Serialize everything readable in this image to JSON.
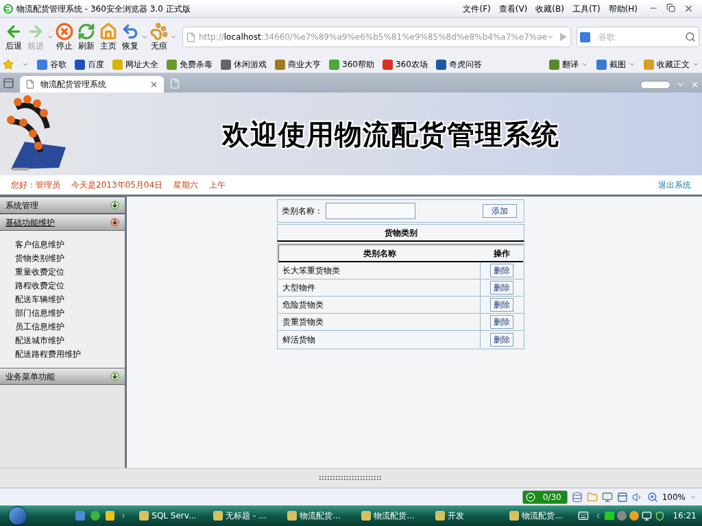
{
  "window": {
    "title": "物流配货管理系统 - 360安全浏览器 3.0 正式版"
  },
  "menu": [
    "文件(F)",
    "查看(V)",
    "收藏(B)",
    "工具(T)",
    "帮助(H)"
  ],
  "toolbar": [
    {
      "label": "后退",
      "disabled": false
    },
    {
      "label": "前进",
      "disabled": true
    },
    {
      "label": "停止",
      "disabled": false
    },
    {
      "label": "刷新",
      "disabled": false
    },
    {
      "label": "主页",
      "disabled": false
    },
    {
      "label": "恢复",
      "disabled": false
    },
    {
      "label": "无痕",
      "disabled": false
    }
  ],
  "address": {
    "scheme": "http://",
    "host": "localhost",
    "rest": ":34660/%e7%89%a9%e6%b5%81%e9%85%8d%e8%b4%a7%e7%ae"
  },
  "search": {
    "placeholder": "谷歌"
  },
  "bookmarks": [
    "谷歌",
    "百度",
    "网址大全",
    "免费杀毒",
    "休闲游戏",
    "商业大亨",
    "360帮助",
    "360农场",
    "奇虎问答"
  ],
  "tools": [
    "翻译",
    "截图",
    "收藏正文"
  ],
  "tabs": [
    {
      "label": "物流配货管理系统",
      "selected": true
    }
  ],
  "banner": {
    "title": "欢迎使用物流配货管理系统"
  },
  "info": {
    "greeting": "您好：管理员",
    "date": "今天是2013年05月04日",
    "weekday": "星期六",
    "period": "上午",
    "logout": "退出系统"
  },
  "sidebar": {
    "sections": [
      {
        "label": "系统管理",
        "expanded": false
      },
      {
        "label": "基础功能维护",
        "expanded": true,
        "items": [
          "客户信息维护",
          "货物类别维护",
          "重量收费定位",
          "路程收费定位",
          "配送车辆维护",
          "部门信息维护",
          "员工信息维护",
          "配送城市维护",
          "配送路程费用维护"
        ]
      },
      {
        "label": "业务菜单功能",
        "expanded": false
      }
    ]
  },
  "form": {
    "label": "类别名称：",
    "button": "添加"
  },
  "table": {
    "title": "货物类别",
    "columns": [
      "类别名称",
      "操作"
    ],
    "rows": [
      {
        "name": "长大笨重货物类",
        "action": "删除"
      },
      {
        "name": "大型物件",
        "action": "删除"
      },
      {
        "name": "危险货物类",
        "action": "删除"
      },
      {
        "name": "贵重货物类",
        "action": "删除"
      },
      {
        "name": "鲜活货物",
        "action": "删除"
      }
    ]
  },
  "status_bar": {
    "counter": "0/30",
    "zoom": "100%"
  },
  "taskbar": {
    "items": [
      "SQL Serv...",
      "无标题 - ...",
      "物流配货...",
      "物流配货...",
      "开发",
      "物流配货..."
    ],
    "clock": "16:21"
  }
}
